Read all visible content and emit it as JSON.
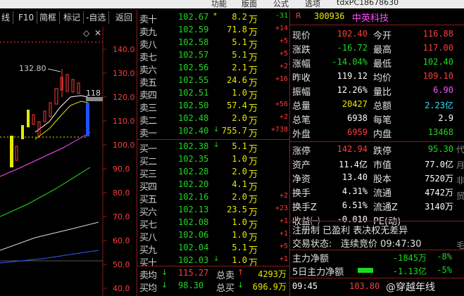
{
  "top_menu": [
    "tdxPC18678630",
    "功能",
    "版面",
    "公式",
    "选项"
  ],
  "toolbar": [
    "线",
    "F10",
    "简框",
    "标记",
    "-自选",
    "返回"
  ],
  "chart": {
    "price_ticks": [
      "140.0",
      "130.0",
      "120.0",
      "110.0",
      "100.0",
      "90.0",
      "80.0",
      "70.0",
      "60.0",
      "50.0",
      "40.0"
    ],
    "peak_label": "132.80",
    "current_marker": "118",
    "icons": [
      "diamond-icon",
      "close-icon"
    ]
  },
  "order_book": {
    "asks": [
      {
        "label": "卖十",
        "price": "102.67",
        "arrow": "*",
        "vol": "8.2",
        "unit": "万",
        "chg": "-31"
      },
      {
        "label": "卖九",
        "price": "102.59",
        "arrow": "",
        "vol": "71.8",
        "unit": "万",
        "chg": "+14"
      },
      {
        "label": "卖八",
        "price": "102.58",
        "arrow": "",
        "vol": "5.1",
        "unit": "万",
        "chg": "+5"
      },
      {
        "label": "卖七",
        "price": "102.57",
        "arrow": "",
        "vol": "5.1",
        "unit": "万",
        "chg": "+5"
      },
      {
        "label": "卖六",
        "price": "102.56",
        "arrow": "",
        "vol": "2.1",
        "unit": "万",
        "chg": "+2"
      },
      {
        "label": "卖五",
        "price": "102.55",
        "arrow": "",
        "vol": "24.6",
        "unit": "万",
        "chg": "+16"
      },
      {
        "label": "卖四",
        "price": "102.51",
        "arrow": "",
        "vol": "1.0",
        "unit": "万",
        "chg": ""
      },
      {
        "label": "卖三",
        "price": "102.50",
        "arrow": "",
        "vol": "57.4",
        "unit": "万",
        "chg": "+56"
      },
      {
        "label": "卖二",
        "price": "102.48",
        "arrow": "",
        "vol": "2.0",
        "unit": "万",
        "chg": "+2"
      },
      {
        "label": "卖一",
        "price": "102.40",
        "arrow": "↓",
        "vol": "755.7",
        "unit": "万",
        "chg": "+738"
      }
    ],
    "bids": [
      {
        "label": "买一",
        "price": "102.38",
        "arrow": "↓",
        "vol": "5.1",
        "unit": "万",
        "chg": ""
      },
      {
        "label": "买二",
        "price": "102.35",
        "arrow": "",
        "vol": "1.0",
        "unit": "万",
        "chg": ""
      },
      {
        "label": "买三",
        "price": "102.28",
        "arrow": "",
        "vol": "2.0",
        "unit": "万",
        "chg": ""
      },
      {
        "label": "买四",
        "price": "102.20",
        "arrow": "",
        "vol": "4.1",
        "unit": "万",
        "chg": ""
      },
      {
        "label": "买五",
        "price": "102.16",
        "arrow": "",
        "vol": "2.0",
        "unit": "万",
        "chg": "+2"
      },
      {
        "label": "买六",
        "price": "102.13",
        "arrow": "",
        "vol": "23.5",
        "unit": "万",
        "chg": "+23"
      },
      {
        "label": "买七",
        "price": "102.08",
        "arrow": "",
        "vol": "1.0",
        "unit": "万",
        "chg": "+1"
      },
      {
        "label": "买八",
        "price": "102.06",
        "arrow": "",
        "vol": "1.0",
        "unit": "万",
        "chg": "+1"
      },
      {
        "label": "买九",
        "price": "102.04",
        "arrow": "",
        "vol": "5.1",
        "unit": "万",
        "chg": "+5"
      },
      {
        "label": "买十",
        "price": "102.03",
        "arrow": "↓",
        "vol": "1.0",
        "unit": "万",
        "chg": "+1"
      }
    ],
    "sell_avg_label": "卖均",
    "sell_avg_arrow": "↓",
    "sell_avg": "115.27",
    "total_sell_label": "总卖",
    "total_sell_arrow": "↑",
    "total_sell": "4293万",
    "buy_avg_label": "买均",
    "buy_avg_arrow": "↓",
    "buy_avg": "98.30",
    "total_buy_label": "总买",
    "total_buy_arrow": "↓",
    "total_buy": "696.9万"
  },
  "quote": {
    "r_badge": "R",
    "code": "300936",
    "name": "中英科技",
    "rows1": [
      {
        "l1": "现价",
        "v1": "102.40",
        "c1": "up",
        "l2": "今开",
        "v2": "116.88",
        "c2": "up"
      },
      {
        "l1": "涨跌",
        "v1": "-16.72",
        "c1": "dn",
        "l2": "最高",
        "v2": "117.00",
        "c2": "up"
      },
      {
        "l1": "涨幅",
        "v1": "-14.04%",
        "c1": "dn",
        "l2": "最低",
        "v2": "102.40",
        "c2": "dn"
      },
      {
        "l1": "昨收",
        "v1": "119.12",
        "c1": "wh",
        "l2": "均价",
        "v2": "109.10",
        "c2": "up"
      },
      {
        "l1": "振幅",
        "v1": "12.26%",
        "c1": "wh",
        "l2": "量比",
        "v2": "6.90",
        "c2": "mag"
      },
      {
        "l1": "总量",
        "v1": "20427",
        "c1": "yl",
        "l2": "总额",
        "v2": "2.23亿",
        "c2": "cy"
      },
      {
        "l1": "总笔",
        "v1": "6938",
        "c1": "wh",
        "l2": "每笔",
        "v2": "2.9",
        "c2": "wh"
      },
      {
        "l1": "外盘",
        "v1": "6959",
        "c1": "up",
        "l2": "内盘",
        "v2": "13468",
        "c2": "dn"
      }
    ],
    "rows2": [
      {
        "l1": "涨停",
        "v1": "142.94",
        "c1": "up",
        "l2": "跌停",
        "v2": "95.30",
        "c2": "dn"
      },
      {
        "l1": "资产",
        "v1": "11.4亿",
        "c1": "wh",
        "l2": "市值",
        "v2": "77.0亿",
        "c2": "wh"
      },
      {
        "l1": "净资",
        "v1": "13.40",
        "c1": "wh",
        "l2": "股本",
        "v2": "7520万",
        "c2": "wh"
      },
      {
        "l1": "换手",
        "v1": "4.31%",
        "c1": "wh",
        "l2": "流通",
        "v2": "4742万",
        "c2": "wh"
      },
      {
        "l1": "换手Z",
        "v1": "6.51%",
        "c1": "wh",
        "l2": "流通Z",
        "v2": "3140万",
        "c2": "wh"
      },
      {
        "l1": "收益㈠",
        "v1": "-0.010",
        "c1": "wh",
        "l2": "PE(动)",
        "v2": "",
        "c2": "wh"
      }
    ],
    "registration": "注册制 已盈利 表决权无差异",
    "trade_status_label": "交易状态:",
    "trade_status": "连续竞价 09:47:30",
    "net_main_label": "主力净额",
    "net_main_value": "-1845万",
    "net_main_pct": "-8%",
    "net_5d_label": "5日主力净额",
    "net_5d_value": "-1.13亿",
    "net_5d_pct": "-5%",
    "tick_time": "09:45",
    "tick_price": "103.80",
    "side_labels": [
      "代",
      "月",
      "非",
      "贸",
      "毛"
    ],
    "watermark": "@穿越年线"
  },
  "colors": {
    "bg": "#000000",
    "up": "#ff3c3c",
    "down": "#20d820",
    "yellow": "#e8e800",
    "border": "#8a1a1a"
  }
}
